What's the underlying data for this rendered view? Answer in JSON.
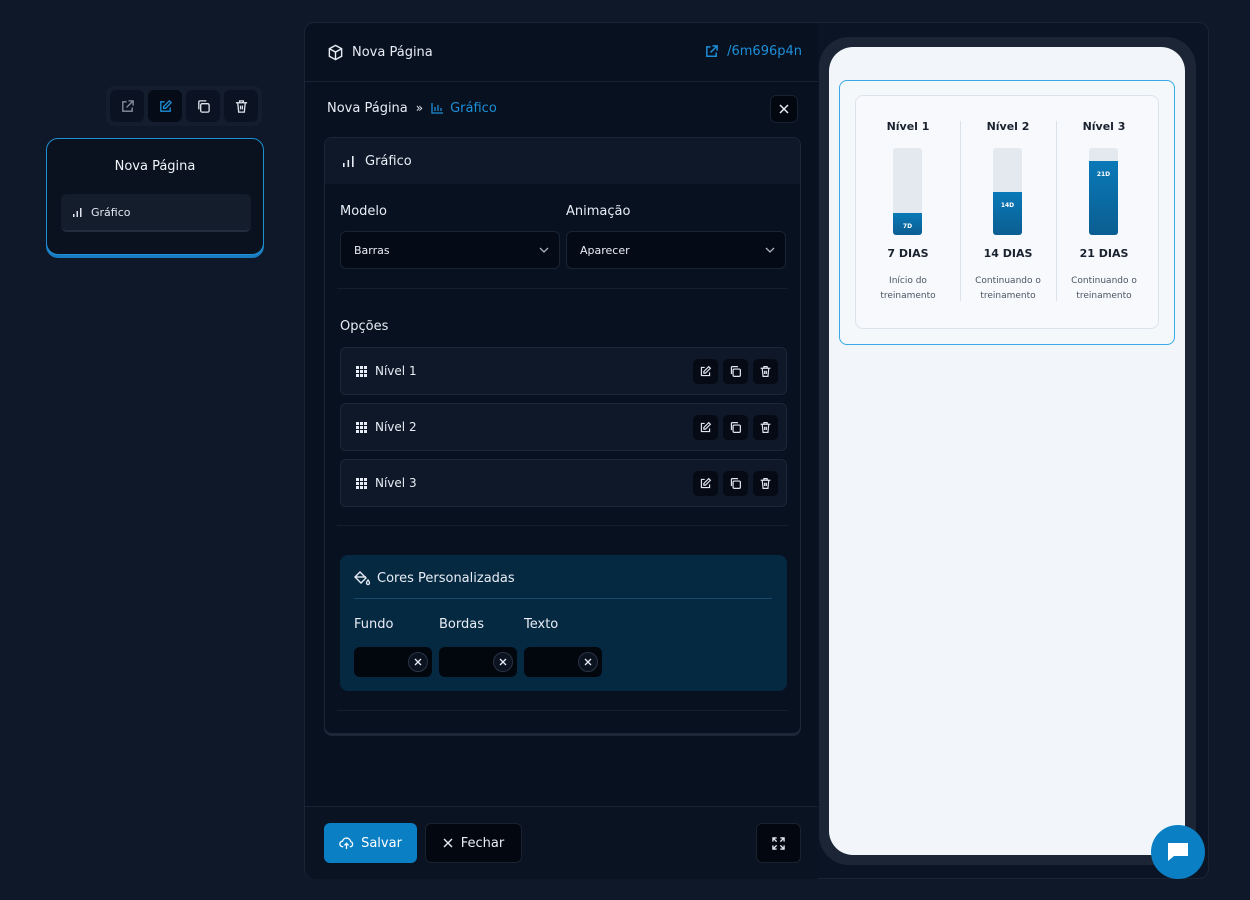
{
  "canvas": {
    "node_title": "Nova Página",
    "node_item": "Gráfico",
    "toolbar": [
      "open-icon",
      "edit-icon",
      "copy-icon",
      "trash-icon"
    ]
  },
  "header": {
    "title": "Nova Página",
    "link": "/6m696p4n"
  },
  "breadcrumb": {
    "parent": "Nova Página",
    "separator": "»",
    "current": "Gráfico"
  },
  "section": {
    "title": "Gráfico",
    "model_label": "Modelo",
    "model_value": "Barras",
    "animation_label": "Animação",
    "animation_value": "Aparecer",
    "options_label": "Opções",
    "options": [
      {
        "label": "Nível 1"
      },
      {
        "label": "Nível 2"
      },
      {
        "label": "Nível 3"
      }
    ],
    "colors": {
      "title": "Cores Personalizadas",
      "fundo": "Fundo",
      "bordas": "Bordas",
      "texto": "Texto"
    }
  },
  "footer": {
    "save": "Salvar",
    "close": "Fechar"
  },
  "preview": {
    "columns": [
      {
        "title": "Nível 1",
        "bar_label": "7D",
        "fill": 0.25,
        "days": "7 DIAS",
        "desc": "Início do treinamento"
      },
      {
        "title": "Nível 2",
        "bar_label": "14D",
        "fill": 0.5,
        "days": "14 DIAS",
        "desc": "Continuando o treinamento"
      },
      {
        "title": "Nível 3",
        "bar_label": "21D",
        "fill": 0.85,
        "days": "21 DIAS",
        "desc": "Continuando o treinamento"
      }
    ]
  },
  "colors": {
    "accent": "#1d8fd8",
    "primary_button": "#0a7fc4",
    "panel_bg": "#081120",
    "custom_colors_bg": "#062942"
  }
}
